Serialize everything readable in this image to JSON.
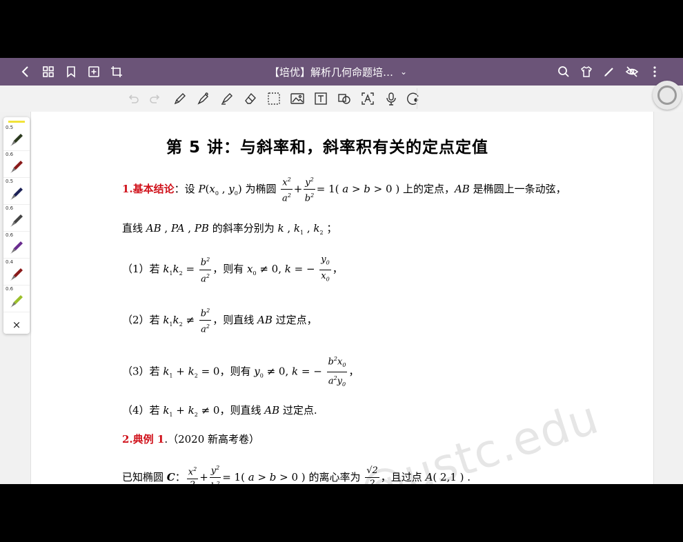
{
  "header": {
    "title": "【培优】解析几何命题培…",
    "title_chevron": "⌄",
    "icons": [
      "back-icon",
      "grid-icon",
      "bookmark-icon",
      "add-page-icon",
      "crop-icon",
      "search-icon",
      "shirt-icon",
      "pen-icon",
      "hide-icon",
      "more-icon"
    ]
  },
  "toolbar": {
    "icons": [
      "undo-icon",
      "redo-icon",
      "pen-tool-icon",
      "fountain-pen-icon",
      "highlighter-icon",
      "eraser-icon",
      "lasso-icon",
      "image-icon",
      "text-icon",
      "shape-icon",
      "ocr-icon",
      "mic-icon",
      "laser-icon"
    ]
  },
  "pens": [
    {
      "size": "0.5",
      "color": "#2b3a1e"
    },
    {
      "size": "0.6",
      "color": "#8a1a1a"
    },
    {
      "size": "0.5",
      "color": "#1c2156"
    },
    {
      "size": "0.6",
      "color": "#444444"
    },
    {
      "size": "0.6",
      "color": "#6a2c8f"
    },
    {
      "size": "0.4",
      "color": "#8a1a1a"
    },
    {
      "size": "0.6",
      "color": "#9bbf2a"
    }
  ],
  "pens_close": "×",
  "doc": {
    "heading": "第 5 讲：与斜率和，斜率积有关的定点定值",
    "basic_label": "1.基本结论",
    "basic_text_a": "：设 ",
    "basic_text_b": " 为椭圆 ",
    "basic_text_c": " 上的定点，",
    "basic_text_d": " 是椭圆上一条动弦，",
    "line2_a": "直线 ",
    "line2_b": " 的斜率分别为 ",
    "line2_c": "；",
    "item1_a": "（1）若 ",
    "item1_b": "，则有 ",
    "item2_a": "（2）若 ",
    "item2_b": "，则直线 ",
    "item2_c": " 过定点，",
    "item3_a": "（3）若 ",
    "item3_b": "，则有 ",
    "item4_a": "（4）若 ",
    "item4_b": "，则直线 ",
    "item4_c": " 过定点.",
    "example_label": "2.典例 1",
    "example_src": ".（2020 新高考卷）",
    "last_a": "已知椭圆 ",
    "last_b": "：",
    "last_c": " 的离心率为 ",
    "last_d": "，且过点 ",
    "watermark": "@ustc.edu"
  }
}
